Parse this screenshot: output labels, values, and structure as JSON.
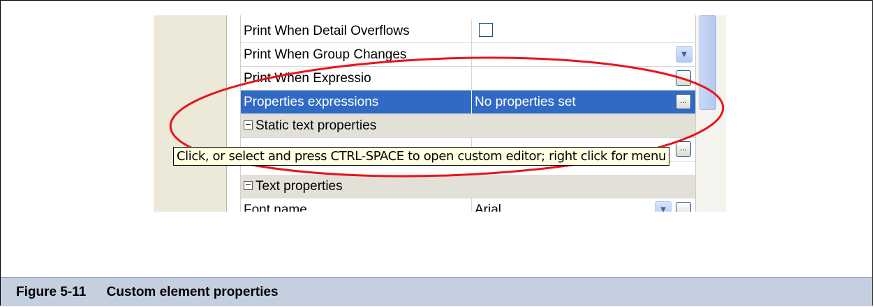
{
  "rows": [
    {
      "name": "Print When Detail Overflows",
      "type": "checkbox"
    },
    {
      "name": "Print When Group Changes",
      "type": "combo"
    },
    {
      "name": "Print When Expressio",
      "type": "ellipsis"
    },
    {
      "name": "Properties expressions",
      "value": "No properties set",
      "type": "ellipsis",
      "selected": true
    },
    {
      "name": "Static text properties",
      "type": "section"
    },
    {
      "name": "Text properties",
      "type": "section"
    },
    {
      "name": "Font name",
      "value": "Arial",
      "type": "combo"
    }
  ],
  "tooltip": "Click, or select and press CTRL-SPACE to open custom editor; right click for menu",
  "ellipsis_glyph": "...",
  "caption": {
    "label": "Figure 5-11",
    "title": "Custom element properties"
  },
  "colors": {
    "selection": "#316ac5",
    "tooltip_bg": "#ffffe1",
    "highlight_ellipse": "#e8141c",
    "caption_bg": "#c4cfe0"
  }
}
